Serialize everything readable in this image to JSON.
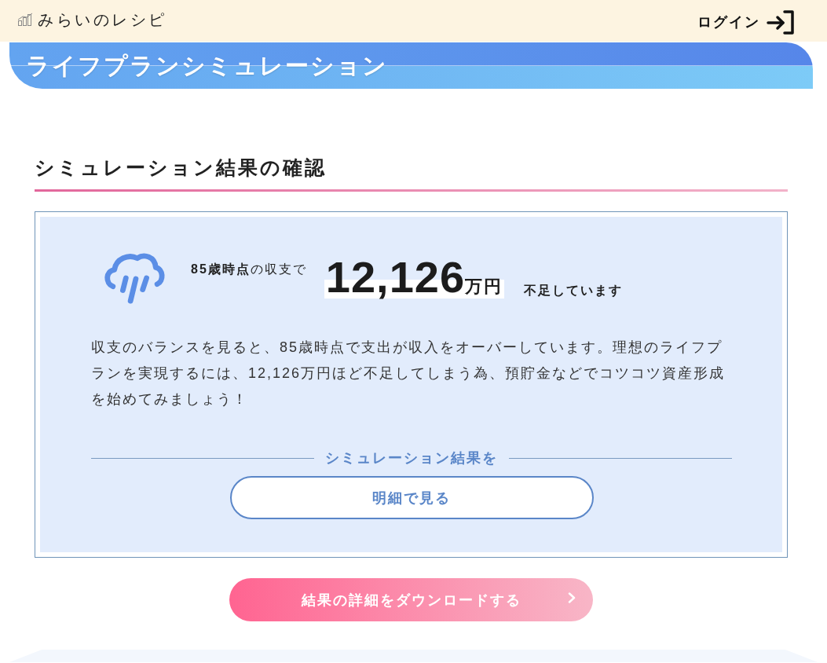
{
  "header": {
    "logo_text": "みらいのレシピ",
    "login_link": "ログイン"
  },
  "banner": {
    "title": "ライフプランシミュレーション"
  },
  "section": {
    "heading": "シミュレーション結果の確認"
  },
  "result": {
    "lead": "**85歳時点**の収支で",
    "amount": "12,126",
    "unit": "万円",
    "status": "不足しています",
    "message": "収支のバランスを見ると、85歳時点で支出が収入をオーバーしています。理想のライフプランを実現するには、12,126万円ほど不足してしまう為、預貯金などでコツコツ資産形成を始めてみましょう！",
    "divider_label": "シミュレーション結果を",
    "detail_button": "明細で見る"
  },
  "download_button": "結果の詳細をダウンロードする"
}
